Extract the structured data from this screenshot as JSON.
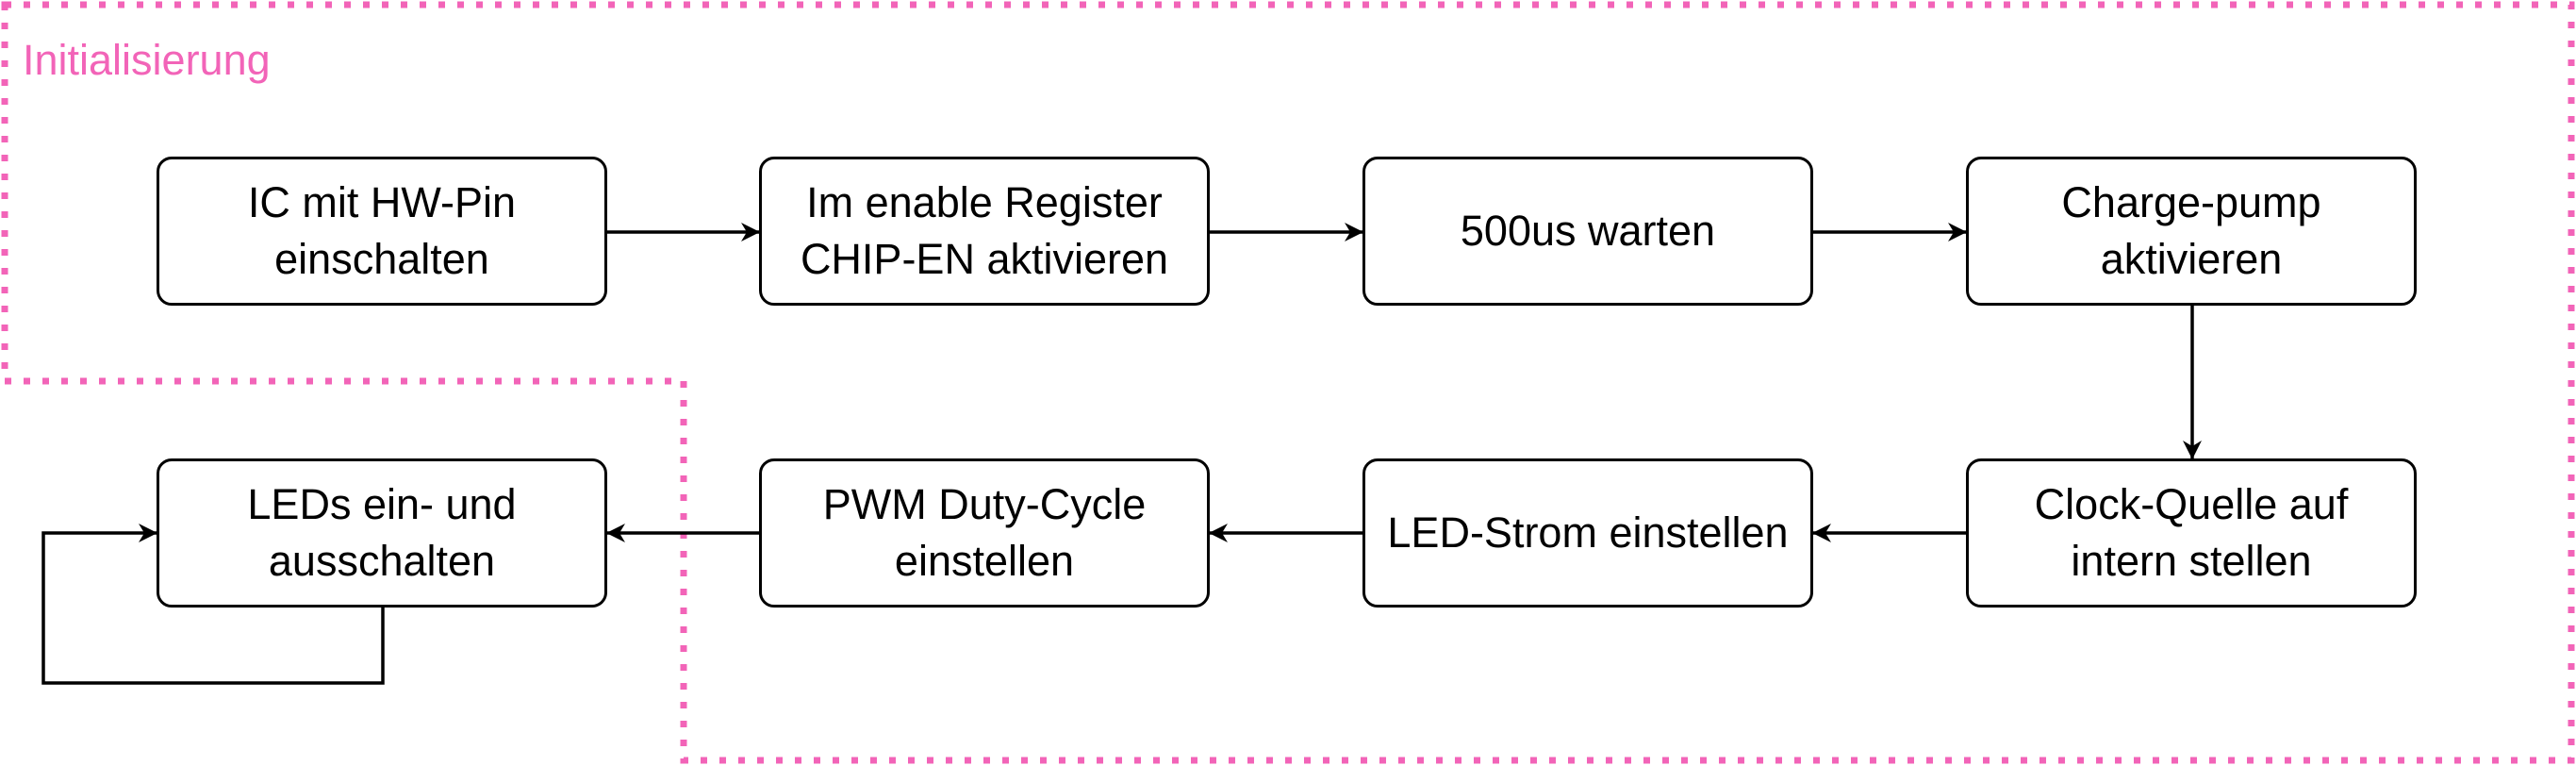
{
  "group": {
    "label": "Initialisierung",
    "color": "#f264b8"
  },
  "nodes": [
    {
      "id": "n1",
      "lines": [
        "IC mit HW-Pin",
        "einschalten"
      ]
    },
    {
      "id": "n2",
      "lines": [
        "Im enable Register",
        "CHIP-EN aktivieren"
      ]
    },
    {
      "id": "n3",
      "lines": [
        "500us warten"
      ]
    },
    {
      "id": "n4",
      "lines": [
        "Charge-pump",
        "aktivieren"
      ]
    },
    {
      "id": "n5",
      "lines": [
        "Clock-Quelle auf",
        "intern stellen"
      ]
    },
    {
      "id": "n6",
      "lines": [
        "LED-Strom einstellen"
      ]
    },
    {
      "id": "n7",
      "lines": [
        "PWM Duty-Cycle",
        "einstellen"
      ]
    },
    {
      "id": "n8",
      "lines": [
        "LEDs ein- und",
        "ausschalten"
      ]
    }
  ],
  "edges": [
    {
      "from": "n1",
      "to": "n2"
    },
    {
      "from": "n2",
      "to": "n3"
    },
    {
      "from": "n3",
      "to": "n4"
    },
    {
      "from": "n4",
      "to": "n5"
    },
    {
      "from": "n5",
      "to": "n6"
    },
    {
      "from": "n6",
      "to": "n7"
    },
    {
      "from": "n7",
      "to": "n8"
    },
    {
      "from": "n8",
      "to": "n8"
    }
  ]
}
